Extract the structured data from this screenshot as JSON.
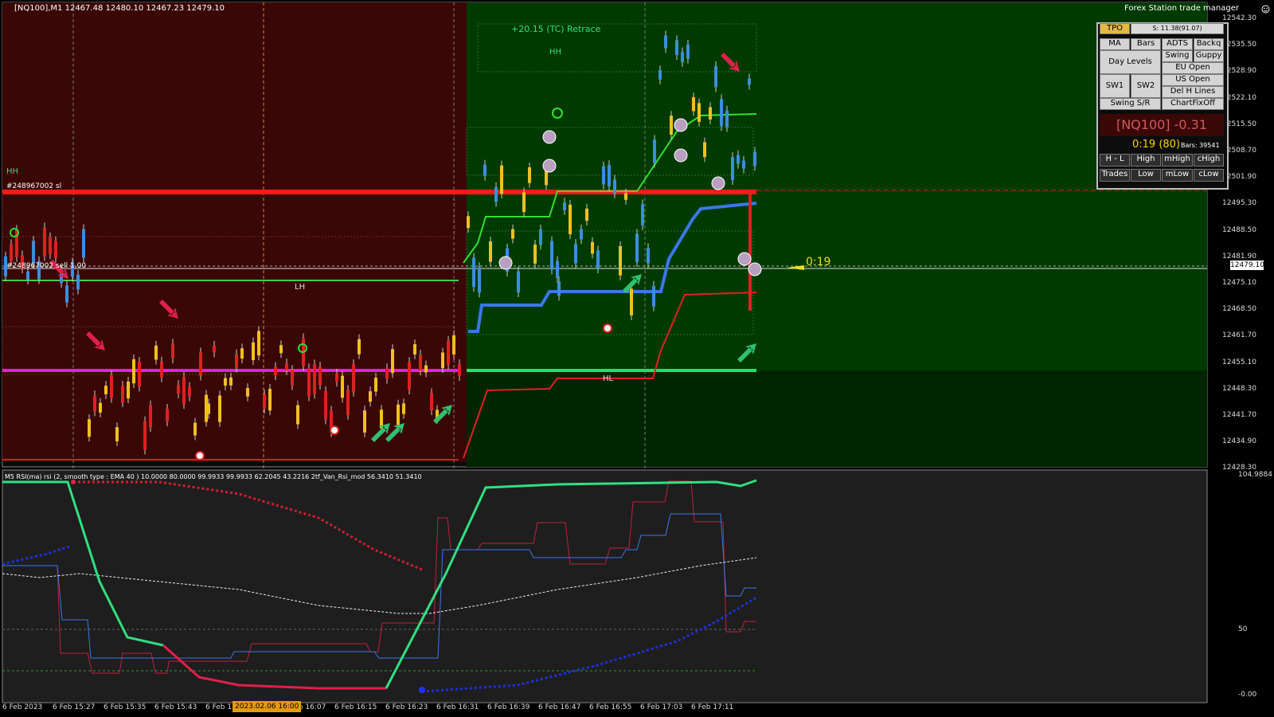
{
  "chart_header": "[NQ100],M1  12467.48 12480.10 12467.23 12479.10",
  "annotations": {
    "retrace": "+20.15 (TC) Retrace",
    "hh_top": "HH",
    "hh_left": "HH",
    "lh": "LH",
    "hl": "HL",
    "sl_label": "#248967002 sl",
    "entry_label": "#248967002 sell 1.00",
    "timer_arrow": "0:19"
  },
  "price_axis": [
    "12542.30",
    "12535.50",
    "12528.90",
    "12522.10",
    "12515.50",
    "12508.70",
    "12501.90",
    "12495.30",
    "12488.50",
    "12481.90",
    "12475.10",
    "12468.50",
    "12461.70",
    "12455.10",
    "12448.30",
    "12441.70",
    "12434.90",
    "12428.30"
  ],
  "current_price": "12479.10",
  "indicator": {
    "header": "M5 RSI(ma) rsi (2, smooth type : EMA  40 ) 10.0000 80.0000 99.9933 99.9933 62.2045 43.2216  2tf_Van_Rsi_mod 56.3410 51.3410",
    "axis_top": "104.9884",
    "axis_mid": "50",
    "axis_bottom": "-0.00"
  },
  "time_axis": [
    "6 Feb 2023",
    "6 Feb 15:27",
    "6 Feb 15:35",
    "6 Feb 15:43",
    "6 Feb 1",
    "6 Feb 16:07",
    "6 Feb 16:15",
    "6 Feb 16:23",
    "6 Feb 16:31",
    "6 Feb 16:39",
    "6 Feb 16:47",
    "6 Feb 16:55",
    "6 Feb 17:03",
    "6 Feb 17:11"
  ],
  "time_highlight": "2023.02.06 16:00",
  "trade_manager": {
    "title": "Forex Station trade manager",
    "tpo": "TPO",
    "spread": "S: 11.38(91.07)",
    "row1": [
      "MA",
      "Bars",
      "ADTS",
      "Backq"
    ],
    "day_levels": "Day Levels",
    "swing": "Swing",
    "guppy": "Guppy",
    "eu_open": "EU Open",
    "us_open": "US Open",
    "sw1": "SW1",
    "sw2": "SW2",
    "del_h_lines": "Del H Lines",
    "swing_sr": "Swing S/R",
    "chartfixoff": "ChartFixOff",
    "symbol": "[NQ100] -0.31",
    "timer": "0:19 (80)",
    "bars": "Bars: 39541",
    "row_high": [
      "H - L",
      "High",
      "mHigh",
      "cHigh"
    ],
    "row_low": [
      "Trades",
      "Low",
      "mLow",
      "cLow"
    ]
  },
  "colors": {
    "bear_zone": "#3a0707",
    "bull_zone": "#003a00",
    "sl_line": "#ff1a1a",
    "magenta_line": "#e020e0",
    "green_line": "#20e070",
    "blue_band": "#3a78e8"
  }
}
